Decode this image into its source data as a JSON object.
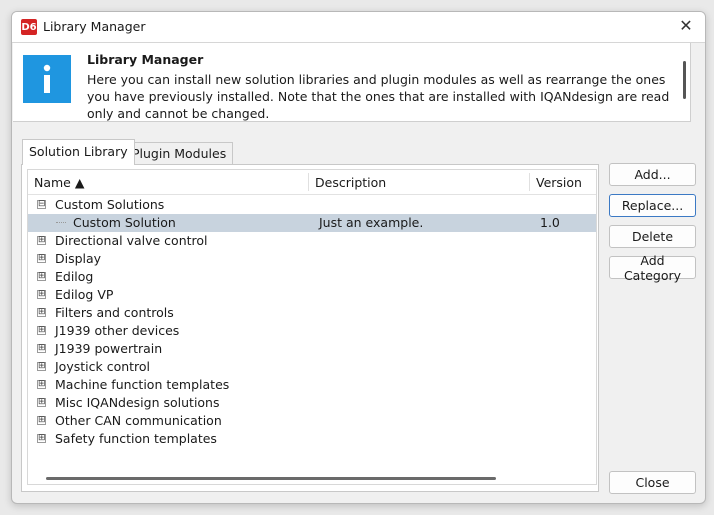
{
  "window": {
    "app_badge": "D6",
    "title": "Library Manager",
    "close_glyph": "✕"
  },
  "banner": {
    "icon": "info-icon",
    "icon_color": "#1f96e0",
    "title": "Library Manager",
    "body": "Here you can install new solution libraries and plugin modules as well as rearrange the ones you have previously installed. Note that the ones that are installed with IQANdesign are read only and cannot be changed."
  },
  "tabs": [
    {
      "label": "Solution Library",
      "active": true
    },
    {
      "label": "Plugin Modules",
      "active": false
    }
  ],
  "table": {
    "columns": {
      "name": "Name ▲",
      "description": "Description",
      "version": "Version"
    },
    "rows": [
      {
        "name": "Custom Solutions",
        "description": "",
        "version": "",
        "expander": "⊟",
        "level": 0
      },
      {
        "name": "Custom Solution",
        "description": "Just an example.",
        "version": "1.0",
        "expander": "",
        "level": 1,
        "selected": true
      },
      {
        "name": "Directional valve control",
        "description": "",
        "version": "",
        "expander": "⊞",
        "level": 0
      },
      {
        "name": "Display",
        "description": "",
        "version": "",
        "expander": "⊞",
        "level": 0
      },
      {
        "name": "Edilog",
        "description": "",
        "version": "",
        "expander": "⊞",
        "level": 0
      },
      {
        "name": "Edilog VP",
        "description": "",
        "version": "",
        "expander": "⊞",
        "level": 0
      },
      {
        "name": "Filters and controls",
        "description": "",
        "version": "",
        "expander": "⊞",
        "level": 0
      },
      {
        "name": "J1939 other devices",
        "description": "",
        "version": "",
        "expander": "⊞",
        "level": 0
      },
      {
        "name": "J1939 powertrain",
        "description": "",
        "version": "",
        "expander": "⊞",
        "level": 0
      },
      {
        "name": "Joystick control",
        "description": "",
        "version": "",
        "expander": "⊞",
        "level": 0
      },
      {
        "name": "Machine function templates",
        "description": "",
        "version": "",
        "expander": "⊞",
        "level": 0
      },
      {
        "name": "Misc IQANdesign solutions",
        "description": "",
        "version": "",
        "expander": "⊞",
        "level": 0
      },
      {
        "name": "Other CAN communication",
        "description": "",
        "version": "",
        "expander": "⊞",
        "level": 0
      },
      {
        "name": "Safety function templates",
        "description": "",
        "version": "",
        "expander": "⊞",
        "level": 0
      }
    ]
  },
  "buttons": {
    "add": "Add...",
    "replace": "Replace...",
    "delete": "Delete",
    "add_category": "Add Category",
    "close": "Close"
  },
  "colors": {
    "selection": "#c8d3de",
    "focus_border": "#3b79c4",
    "badge": "#d42424"
  }
}
